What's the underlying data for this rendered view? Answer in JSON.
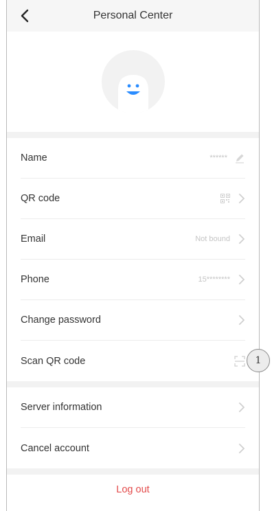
{
  "header": {
    "title": "Personal Center",
    "back_icon": "chevron-left-icon"
  },
  "profile": {
    "avatar_icon": "smiley-avatar-icon"
  },
  "rows": [
    {
      "label": "Name",
      "value": "******",
      "icon": "pencil-icon"
    },
    {
      "label": "QR code",
      "icon": "qr-code-icon"
    },
    {
      "label": "Email",
      "value": "Not bound"
    },
    {
      "label": "Phone",
      "value": "15********"
    },
    {
      "label": "Change password"
    },
    {
      "label": "Scan QR code",
      "icon": "scan-icon"
    },
    {
      "label": "Server information"
    },
    {
      "label": "Cancel account"
    }
  ],
  "logout": {
    "label": "Log out"
  },
  "callout": {
    "label": "1"
  },
  "colors": {
    "accent": "#2a8cff",
    "danger": "#e34b4b",
    "section_gap": "#f2f2f2"
  }
}
